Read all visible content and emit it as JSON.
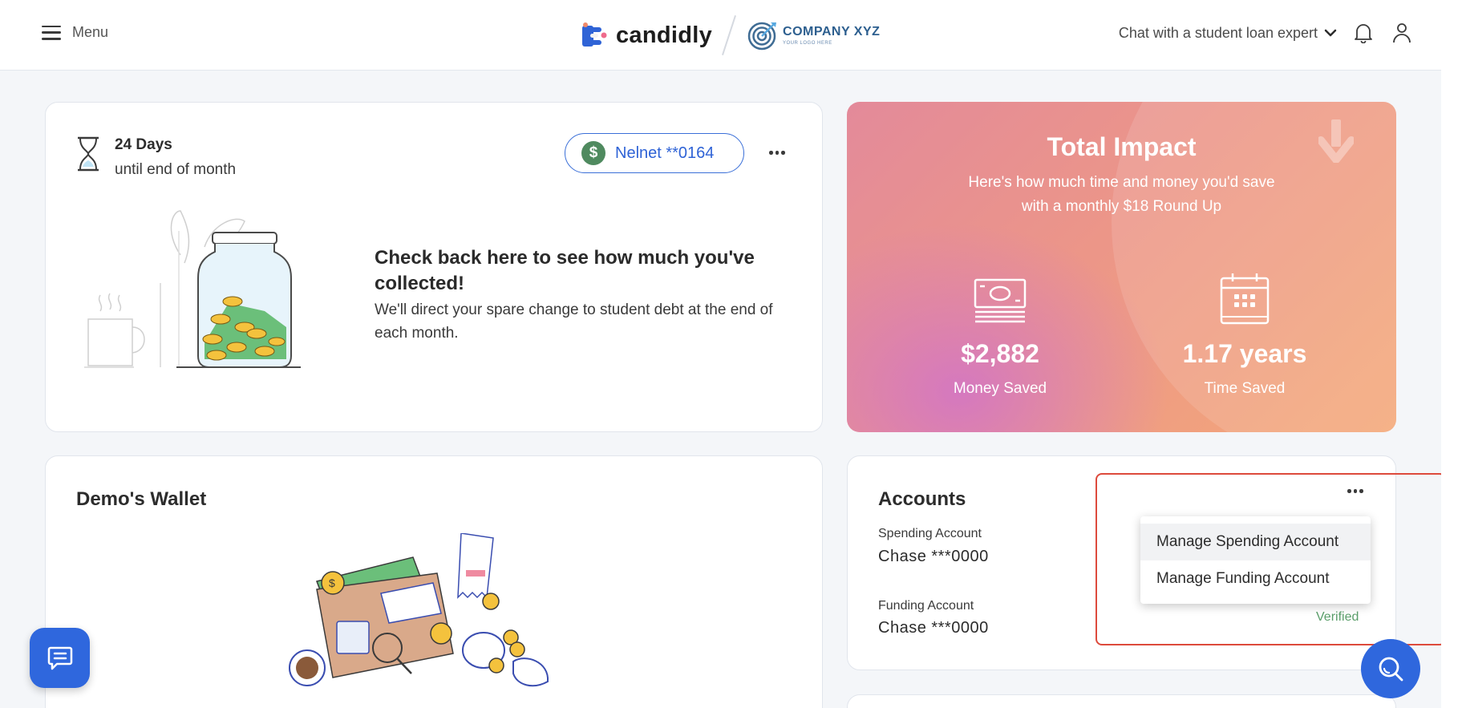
{
  "header": {
    "menu_label": "Menu",
    "brand_name": "candidly",
    "company_name": "COMPANY XYZ",
    "company_tagline": "YOUR LOGO HERE",
    "chat_expert_label": "Chat with a student loan expert"
  },
  "savings": {
    "days": "24 Days",
    "days_sub": "until end of month",
    "loan_pill": "Nelnet **0164",
    "title": "Check back here to see how much you've collected!",
    "description": "We'll direct your spare change to student debt at the end of each month."
  },
  "impact": {
    "title": "Total Impact",
    "subtitle_line1": "Here's how much time and money you'd save",
    "subtitle_line2": "with a monthly $18 Round Up",
    "money_value": "$2,882",
    "money_label": "Money Saved",
    "time_value": "1.17 years",
    "time_label": "Time Saved"
  },
  "wallet": {
    "title": "Demo's Wallet"
  },
  "accounts": {
    "title": "Accounts",
    "spending_label": "Spending Account",
    "spending_value": "Chase ***0000",
    "funding_label": "Funding Account",
    "funding_value": "Chase ***0000",
    "funding_status": "Verified",
    "menu_items": [
      "Manage Spending Account",
      "Manage Funding Account"
    ]
  },
  "colors": {
    "primary": "#2f67dd",
    "highlight": "#dd4a3c",
    "verified": "#5a9e6a"
  }
}
